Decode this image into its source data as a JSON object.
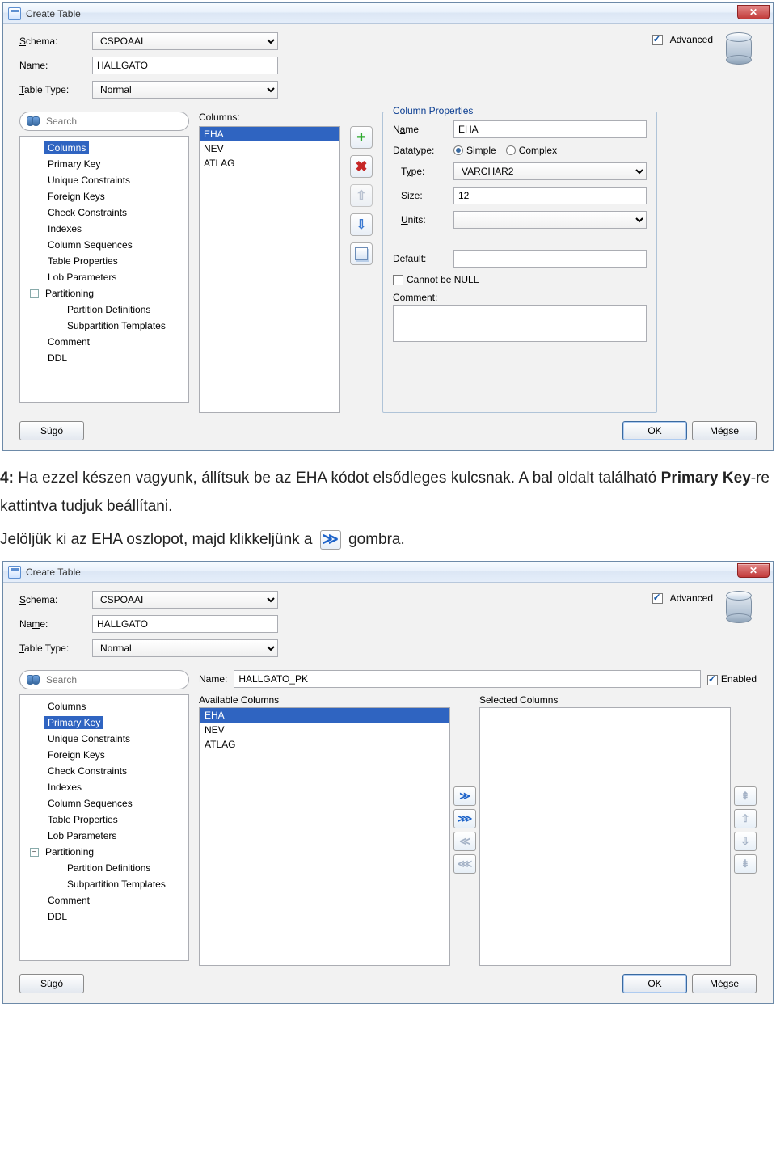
{
  "dialog1": {
    "title": "Create Table",
    "form": {
      "schema_label": "Schema:",
      "schema_value": "CSPOAAI",
      "name_label": "Name:",
      "name_value": "HALLGATO",
      "type_label": "Table Type:",
      "type_value": "Normal",
      "advanced_label": "Advanced",
      "advanced_checked": true
    },
    "search_placeholder": "Search",
    "tree": {
      "items": [
        "Columns",
        "Primary Key",
        "Unique Constraints",
        "Foreign Keys",
        "Check Constraints",
        "Indexes",
        "Column Sequences",
        "Table Properties",
        "Lob Parameters"
      ],
      "partitioning_label": "Partitioning",
      "partition_children": [
        "Partition Definitions",
        "Subpartition Templates"
      ],
      "tail": [
        "Comment",
        "DDL"
      ],
      "selected": "Columns"
    },
    "columns_header": "Columns:",
    "columns": [
      "EHA",
      "NEV",
      "ATLAG"
    ],
    "columns_selected": "EHA",
    "props": {
      "legend": "Column Properties",
      "name_label": "Name",
      "name_value": "EHA",
      "datatype_label": "Datatype:",
      "simple_label": "Simple",
      "complex_label": "Complex",
      "type_label": "Type:",
      "type_value": "VARCHAR2",
      "size_label": "Size:",
      "size_value": "12",
      "units_label": "Units:",
      "units_value": "",
      "default_label": "Default:",
      "default_value": "",
      "notnull_label": "Cannot be NULL",
      "comment_label": "Comment:",
      "comment_value": ""
    },
    "footer": {
      "help": "Súgó",
      "ok": "OK",
      "cancel": "Mégse"
    }
  },
  "paragraph": {
    "line1a": "4:",
    "line1b": " Ha ezzel készen vagyunk, állítsuk be az EHA kódot elsődleges kulcsnak. A bal oldalt található ",
    "pkbold": "Primary Key",
    "line1c": "-re kattintva tudjuk beállítani.",
    "line2a": "Jelöljük ki az EHA oszlopot, majd klikkeljünk a",
    "line2b": " gombra."
  },
  "dialog2": {
    "title": "Create Table",
    "form": {
      "schema_label": "Schema:",
      "schema_value": "CSPOAAI",
      "name_label": "Name:",
      "name_value": "HALLGATO",
      "type_label": "Table Type:",
      "type_value": "Normal",
      "advanced_label": "Advanced",
      "advanced_checked": true
    },
    "search_placeholder": "Search",
    "tree": {
      "items": [
        "Columns",
        "Primary Key",
        "Unique Constraints",
        "Foreign Keys",
        "Check Constraints",
        "Indexes",
        "Column Sequences",
        "Table Properties",
        "Lob Parameters"
      ],
      "partitioning_label": "Partitioning",
      "partition_children": [
        "Partition Definitions",
        "Subpartition Templates"
      ],
      "tail": [
        "Comment",
        "DDL"
      ],
      "selected": "Primary Key"
    },
    "pk": {
      "name_label": "Name:",
      "name_value": "HALLGATO_PK",
      "enabled_label": "Enabled",
      "enabled_checked": true,
      "avail_header": "Available Columns",
      "sel_header": "Selected Columns",
      "available": [
        "EHA",
        "NEV",
        "ATLAG"
      ],
      "available_selected": "EHA",
      "selected": []
    },
    "footer": {
      "help": "Súgó",
      "ok": "OK",
      "cancel": "Mégse"
    }
  }
}
